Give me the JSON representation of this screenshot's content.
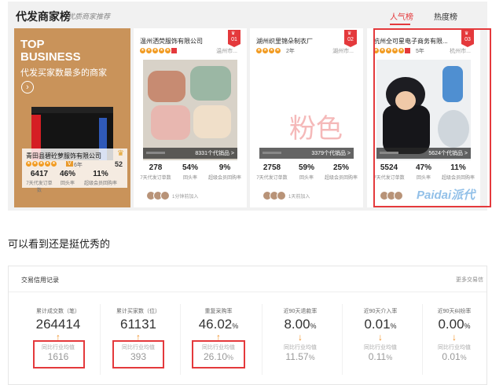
{
  "header": {
    "title": "代发商家榜",
    "subtitle": "优质商家推荐",
    "tabs": [
      {
        "label": "人气榜",
        "active": true
      },
      {
        "label": "热度榜",
        "active": false
      }
    ]
  },
  "banner": {
    "line1": "TOP",
    "line2": "BUSINESS",
    "sub": "代发买家数最多的商家",
    "shop_name": "青田县碧砼萝服饰有限公司",
    "year": "6年",
    "rank": "52",
    "stats": [
      {
        "value": "6417",
        "label": "7天代发订单数"
      },
      {
        "value": "46%",
        "label": "回头率"
      },
      {
        "value": "11%",
        "label": "超级会员回购率"
      }
    ]
  },
  "cards": [
    {
      "name": "温州洒荧服饰有限公司",
      "rank": "01",
      "location": "温州市...",
      "year": "",
      "product_count": "8331个代销品 >",
      "stats": [
        {
          "value": "278",
          "label": "7天代发订单数"
        },
        {
          "value": "54%",
          "label": "回头率"
        },
        {
          "value": "9%",
          "label": "超级会员回购率"
        }
      ],
      "footer": "1分钟前加入"
    },
    {
      "name": "湖州织里锦朵制衣厂",
      "rank": "02",
      "location": "湖州市...",
      "year": "2年",
      "image_text": "粉色",
      "product_count": "3379个代销品 >",
      "stats": [
        {
          "value": "2758",
          "label": "7天代发订单数"
        },
        {
          "value": "59%",
          "label": "回头率"
        },
        {
          "value": "25%",
          "label": "超级会员回购率"
        }
      ],
      "footer": "1天前加入"
    },
    {
      "name": "杭州全可星电子商务有限...",
      "rank": "03",
      "location": "杭州市...",
      "year": "5年",
      "product_count": "5624个代销品 >",
      "stats": [
        {
          "value": "5524",
          "label": "7天代发订单数"
        },
        {
          "value": "47%",
          "label": "回头率"
        },
        {
          "value": "11%",
          "label": "超级会员回购率"
        }
      ],
      "footer": ""
    }
  ],
  "watermark": "Paidai派代",
  "middle_text": "可以看到还是挺优秀的",
  "credit": {
    "title": "交易信用记录",
    "more": "更多交易信",
    "compare_label": "同比行业均值",
    "metrics": [
      {
        "label": "累计成交数（笔）",
        "value": "264414",
        "compare": "1616",
        "unit": ""
      },
      {
        "label": "累计买家数（位）",
        "value": "61131",
        "compare": "393",
        "unit": ""
      },
      {
        "label": "重复采购率",
        "value": "46.02",
        "compare": "26.10",
        "unit": "%"
      },
      {
        "label": "近90天退款率",
        "value": "8.00",
        "compare": "11.57",
        "unit": "%"
      },
      {
        "label": "近90天介入率",
        "value": "0.01",
        "compare": "0.11",
        "unit": "%"
      },
      {
        "label": "近90天纠纷率",
        "value": "0.00",
        "compare": "0.01",
        "unit": "%"
      }
    ]
  },
  "colors": {
    "accent": "#e4393c",
    "orange": "#f08a1c",
    "banner": "#c9935a"
  }
}
